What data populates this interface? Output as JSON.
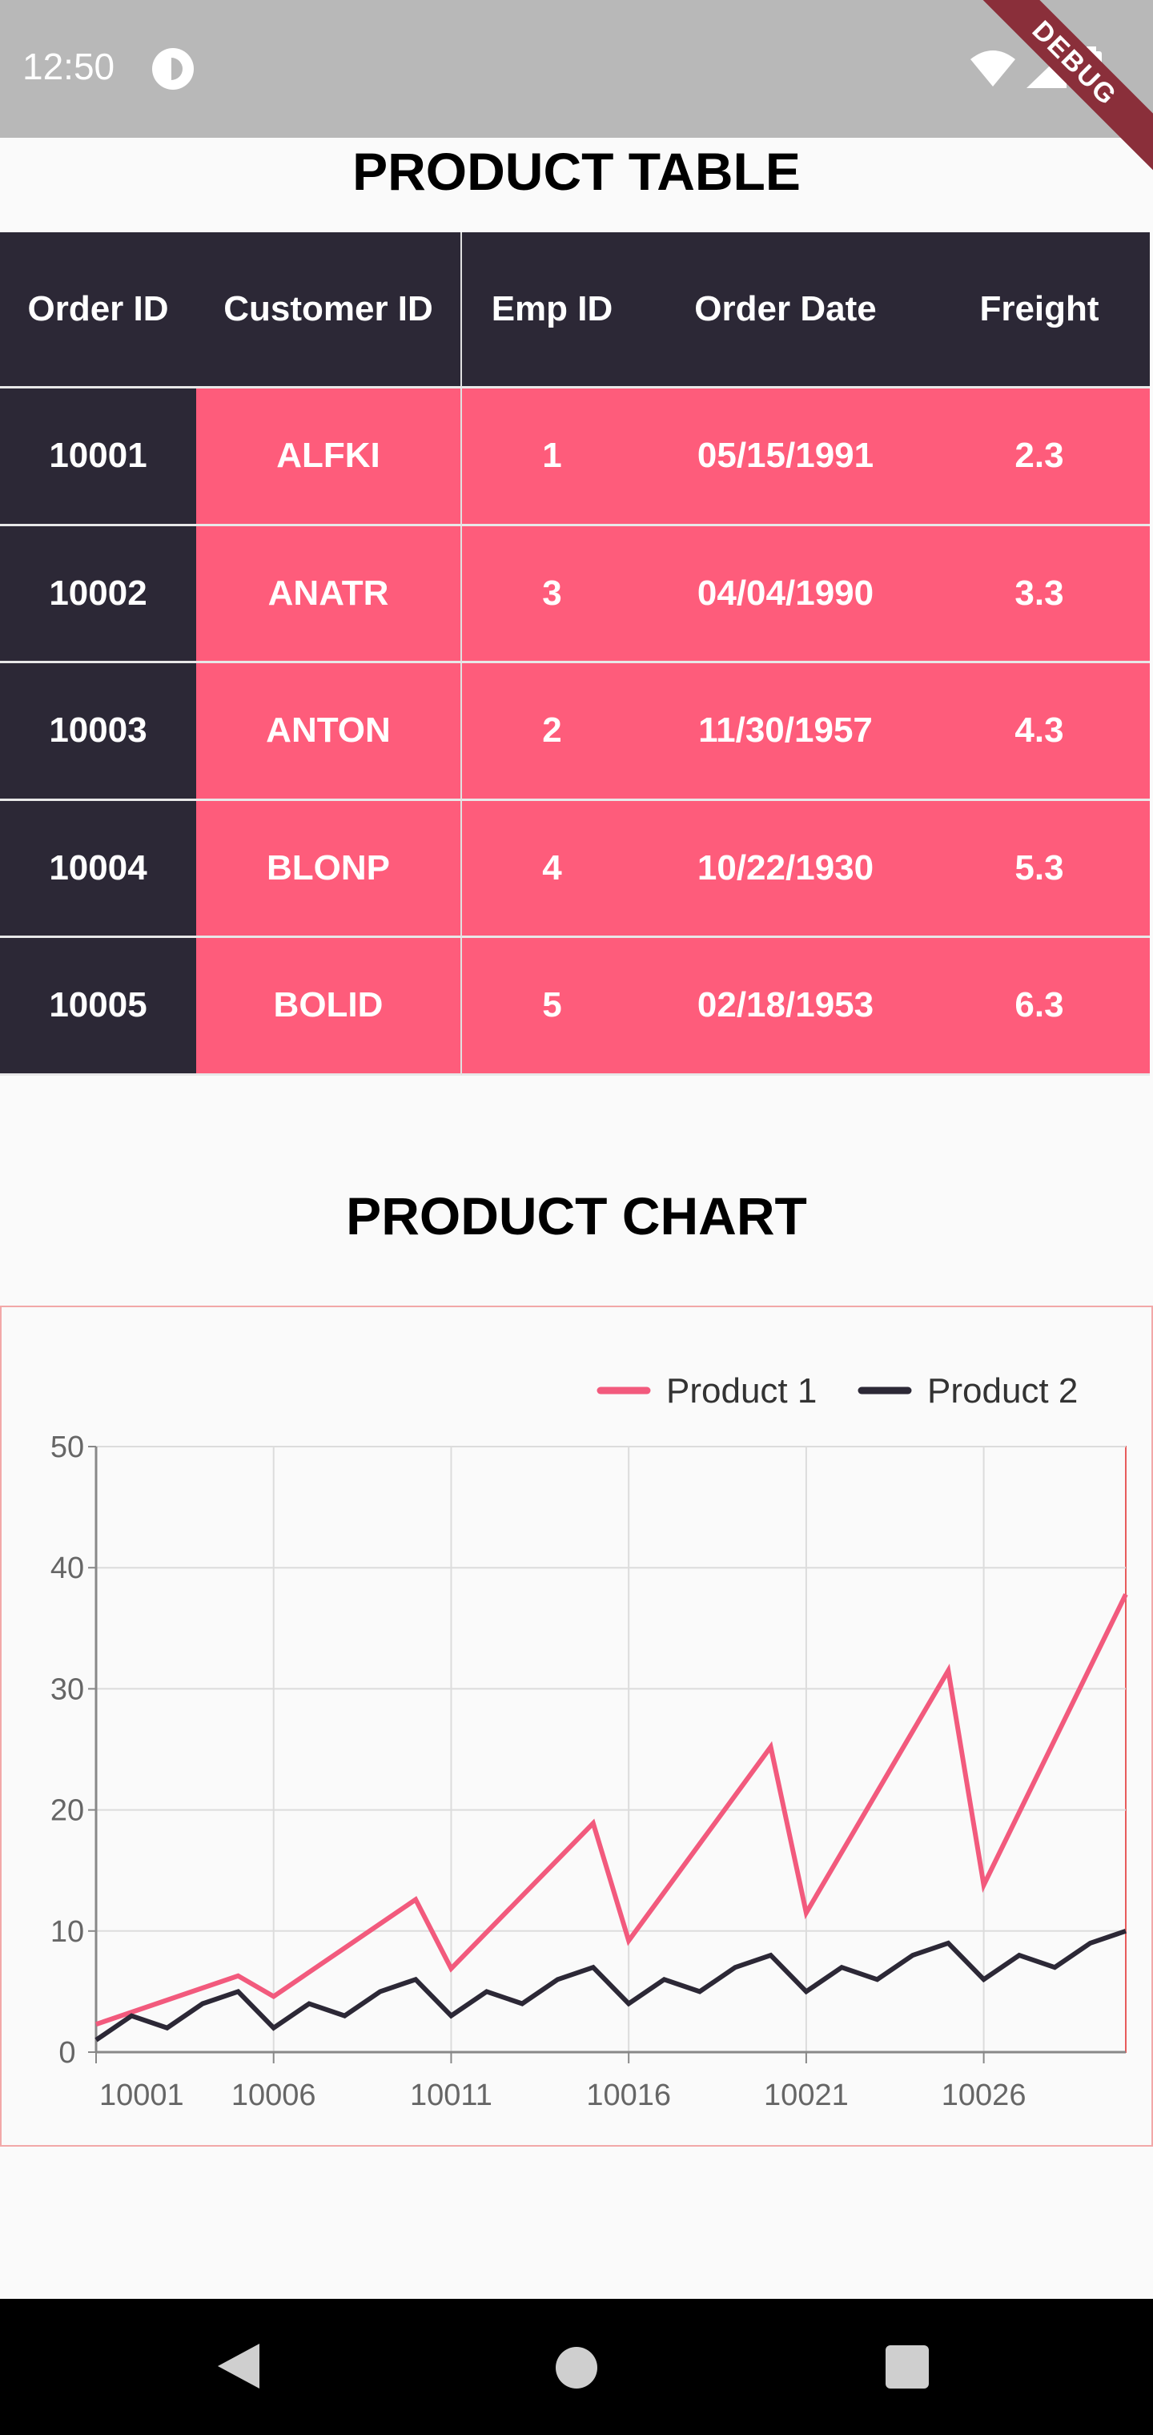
{
  "status_bar": {
    "time": "12:50",
    "debug_label": "DEBUG"
  },
  "table_section": {
    "title": "PRODUCT TABLE",
    "columns": [
      "Order ID",
      "Customer ID",
      "Emp ID",
      "Order Date",
      "Freight"
    ],
    "rows": [
      [
        "10001",
        "ALFKI",
        "1",
        "05/15/1991",
        "2.3"
      ],
      [
        "10002",
        "ANATR",
        "3",
        "04/04/1990",
        "3.3"
      ],
      [
        "10003",
        "ANTON",
        "2",
        "11/30/1957",
        "4.3"
      ],
      [
        "10004",
        "BLONP",
        "4",
        "10/22/1930",
        "5.3"
      ],
      [
        "10005",
        "BOLID",
        "5",
        "02/18/1953",
        "6.3"
      ]
    ],
    "colors": {
      "frozen_column": "#2c2836",
      "body": "#fe5c7b",
      "text": "#ffffff"
    }
  },
  "chart_section": {
    "title": "PRODUCT CHART"
  },
  "chart_data": {
    "type": "line",
    "title": "",
    "xlabel": "",
    "ylabel": "",
    "x": [
      10001,
      10002,
      10003,
      10004,
      10005,
      10006,
      10007,
      10008,
      10009,
      10010,
      10011,
      10012,
      10013,
      10014,
      10015,
      10016,
      10017,
      10018,
      10019,
      10020,
      10021,
      10022,
      10023,
      10024,
      10025,
      10026,
      10027,
      10028,
      10029,
      10030
    ],
    "x_tick_labels": [
      "10001",
      "10006",
      "10011",
      "10016",
      "10021",
      "10026"
    ],
    "y_ticks": [
      0,
      10,
      20,
      30,
      40,
      50
    ],
    "ylim": [
      0,
      50
    ],
    "grid": true,
    "legend_position": "top-right",
    "series": [
      {
        "name": "Product 1",
        "color": "#f25a7d",
        "values": [
          2.3,
          3.3,
          4.3,
          5.3,
          6.3,
          4.6,
          6.6,
          8.6,
          10.6,
          12.6,
          6.9,
          9.9,
          12.9,
          15.9,
          18.9,
          9.2,
          13.2,
          17.2,
          21.2,
          25.2,
          11.5,
          16.5,
          21.5,
          26.5,
          31.5,
          13.8,
          19.8,
          25.8,
          31.8,
          37.8
        ]
      },
      {
        "name": "Product 2",
        "color": "#2c2836",
        "values": [
          1,
          3,
          2,
          4,
          5,
          2,
          4,
          3,
          5,
          6,
          3,
          5,
          4,
          6,
          7,
          4,
          6,
          5,
          7,
          8,
          5,
          7,
          6,
          8,
          9,
          6,
          8,
          7,
          9,
          10
        ]
      }
    ]
  }
}
